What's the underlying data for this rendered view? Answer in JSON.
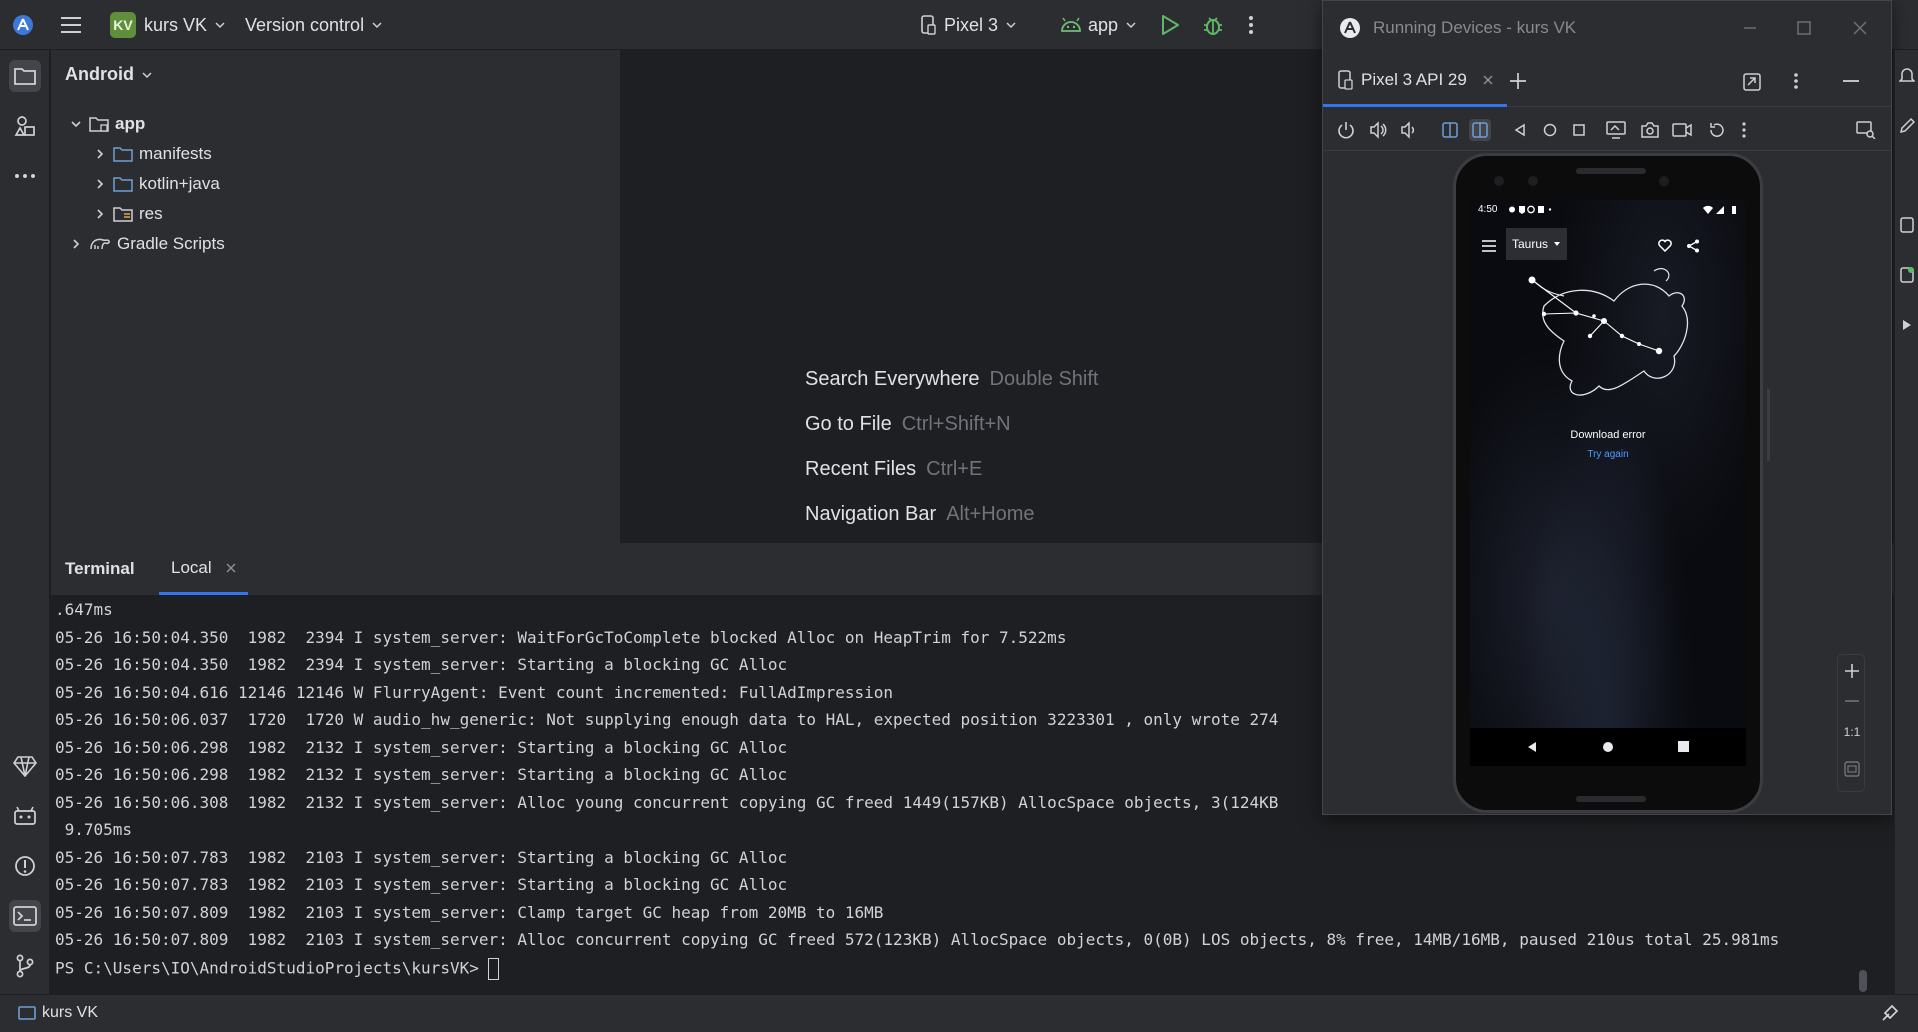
{
  "topbar": {
    "project_badge": "KV",
    "project_name": "kurs VK",
    "version_control": "Version control",
    "device": "Pixel 3",
    "run_config": "app"
  },
  "project_panel": {
    "view": "Android",
    "tree": [
      {
        "label": "app",
        "icon": "module-folder-icon"
      },
      {
        "label": "manifests",
        "icon": "folder-icon"
      },
      {
        "label": "kotlin+java",
        "icon": "folder-icon"
      },
      {
        "label": "res",
        "icon": "resource-folder-icon"
      },
      {
        "label": "Gradle Scripts",
        "icon": "gradle-icon"
      }
    ]
  },
  "editor_hints": [
    {
      "action": "Search Everywhere",
      "shortcut": "Double Shift"
    },
    {
      "action": "Go to File",
      "shortcut": "Ctrl+Shift+N"
    },
    {
      "action": "Recent Files",
      "shortcut": "Ctrl+E"
    },
    {
      "action": "Navigation Bar",
      "shortcut": "Alt+Home"
    }
  ],
  "terminal": {
    "title": "Terminal",
    "tab": "Local",
    "lines": [
      ".647ms",
      "05-26 16:50:04.350  1982  2394 I system_server: WaitForGcToComplete blocked Alloc on HeapTrim for 7.522ms",
      "05-26 16:50:04.350  1982  2394 I system_server: Starting a blocking GC Alloc",
      "05-26 16:50:04.616 12146 12146 W FlurryAgent: Event count incremented: FullAdImpression",
      "05-26 16:50:06.037  1720  1720 W audio_hw_generic: Not supplying enough data to HAL, expected position 3223301 , only wrote 274",
      "05-26 16:50:06.298  1982  2132 I system_server: Starting a blocking GC Alloc",
      "05-26 16:50:06.298  1982  2132 I system_server: Starting a blocking GC Alloc",
      "05-26 16:50:06.308  1982  2132 I system_server: Alloc young concurrent copying GC freed 1449(157KB) AllocSpace objects, 3(124KB",
      " 9.705ms",
      "05-26 16:50:07.783  1982  2103 I system_server: Starting a blocking GC Alloc",
      "05-26 16:50:07.783  1982  2103 I system_server: Starting a blocking GC Alloc",
      "05-26 16:50:07.809  1982  2103 I system_server: Clamp target GC heap from 20MB to 16MB",
      "05-26 16:50:07.809  1982  2103 I system_server: Alloc concurrent copying GC freed 572(123KB) AllocSpace objects, 0(0B) LOS objects, 8% free, 14MB/16MB, paused 210us total 25.981ms",
      "PS C:\\Users\\IO\\AndroidStudioProjects\\kursVK> "
    ]
  },
  "status_bar": {
    "project": "kurs VK"
  },
  "running_devices": {
    "title": "Running Devices - kurs VK",
    "tab": "Pixel 3 API 29",
    "zoom_label": "1:1",
    "phone": {
      "time": "4:50",
      "toolbar_title": "Taurus",
      "error_text": "Download error",
      "retry_text": "Try again"
    }
  },
  "colors": {
    "accent": "#3574f0",
    "run_green": "#5fb865",
    "link_blue": "#4a9cff",
    "android_green": "#73bd79"
  }
}
